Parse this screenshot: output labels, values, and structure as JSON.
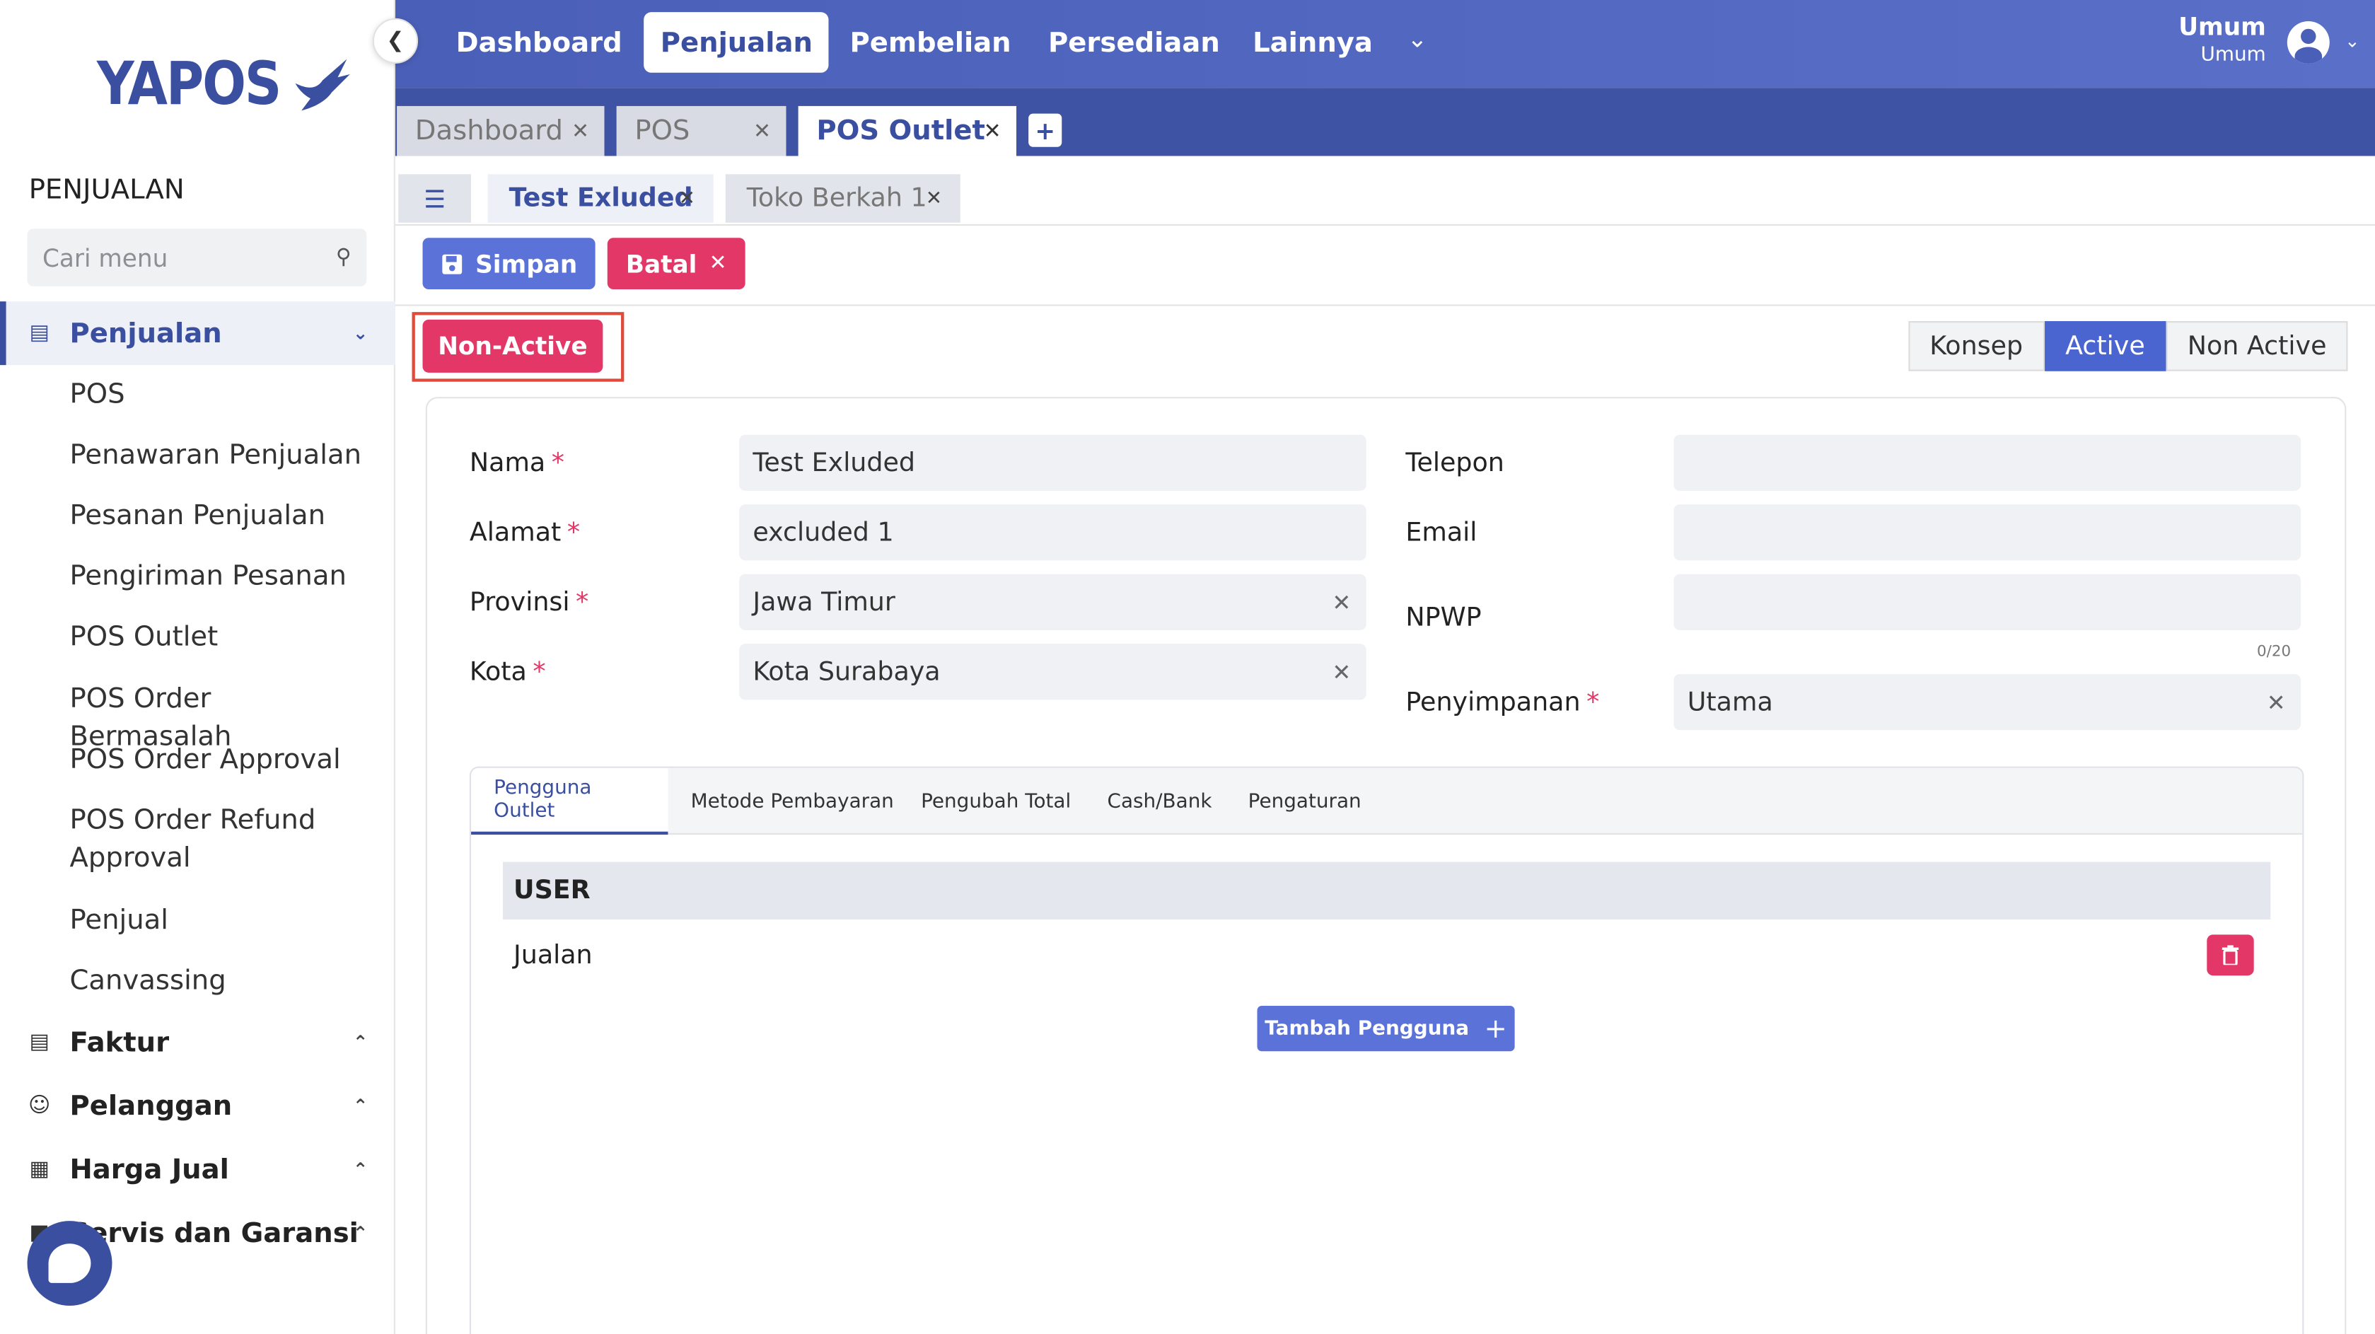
{
  "brand": {
    "name": "YAPOS",
    "color": "#3a4fa0"
  },
  "sidebar": {
    "heading": "PENJUALAN",
    "search_placeholder": "Cari menu",
    "groups": [
      {
        "label": "Penjualan",
        "icon": "list-icon",
        "expanded": true
      },
      {
        "label": "Faktur",
        "icon": "receipt-icon"
      },
      {
        "label": "Pelanggan",
        "icon": "smile-icon"
      },
      {
        "label": "Harga Jual",
        "icon": "barcode-icon"
      },
      {
        "label": "Servis dan Garansi",
        "icon": "tool-icon"
      }
    ],
    "sub_items": [
      "POS",
      "Penawaran Penjualan",
      "Pesanan Penjualan",
      "Pengiriman Pesanan",
      "POS Outlet",
      "POS Order Bermasalah",
      "POS Order Approval",
      "POS Order Refund Approval",
      "Penjual",
      "Canvassing"
    ]
  },
  "topnav": {
    "items": [
      "Dashboard",
      "Penjualan",
      "Pembelian",
      "Persediaan",
      "Lainnya"
    ],
    "active": "Penjualan",
    "user_name": "Umum",
    "user_role": "Umum"
  },
  "window_tabs": [
    {
      "label": "Dashboard"
    },
    {
      "label": "POS"
    },
    {
      "label": "POS Outlet",
      "active": true
    }
  ],
  "record_tabs": [
    {
      "label": "Test Exluded",
      "active": true
    },
    {
      "label": "Toko Berkah 1"
    }
  ],
  "toolbar": {
    "save_label": "Simpan",
    "cancel_label": "Batal"
  },
  "status": {
    "action_label": "Non-Active",
    "steps": [
      "Konsep",
      "Active",
      "Non Active"
    ],
    "current": "Active"
  },
  "form": {
    "nama_label": "Nama",
    "nama_value": "Test Exluded",
    "alamat_label": "Alamat",
    "alamat_value": "excluded 1",
    "provinsi_label": "Provinsi",
    "provinsi_value": "Jawa Timur",
    "kota_label": "Kota",
    "kota_value": "Kota Surabaya",
    "telepon_label": "Telepon",
    "telepon_value": "",
    "email_label": "Email",
    "email_value": "",
    "npwp_label": "NPWP",
    "npwp_value": "",
    "npwp_counter": "0/20",
    "penyimpanan_label": "Penyimpanan",
    "penyimpanan_value": "Utama"
  },
  "detail_tabs": [
    "Pengguna Outlet",
    "Metode Pembayaran",
    "Pengubah Total",
    "Cash/Bank",
    "Pengaturan"
  ],
  "users_table": {
    "header": "USER",
    "rows": [
      "Jualan"
    ],
    "add_label": "Tambah Pengguna"
  },
  "colors": {
    "primary": "#5b72d8",
    "danger": "#e33867",
    "topbar": "#4a5fb8"
  }
}
